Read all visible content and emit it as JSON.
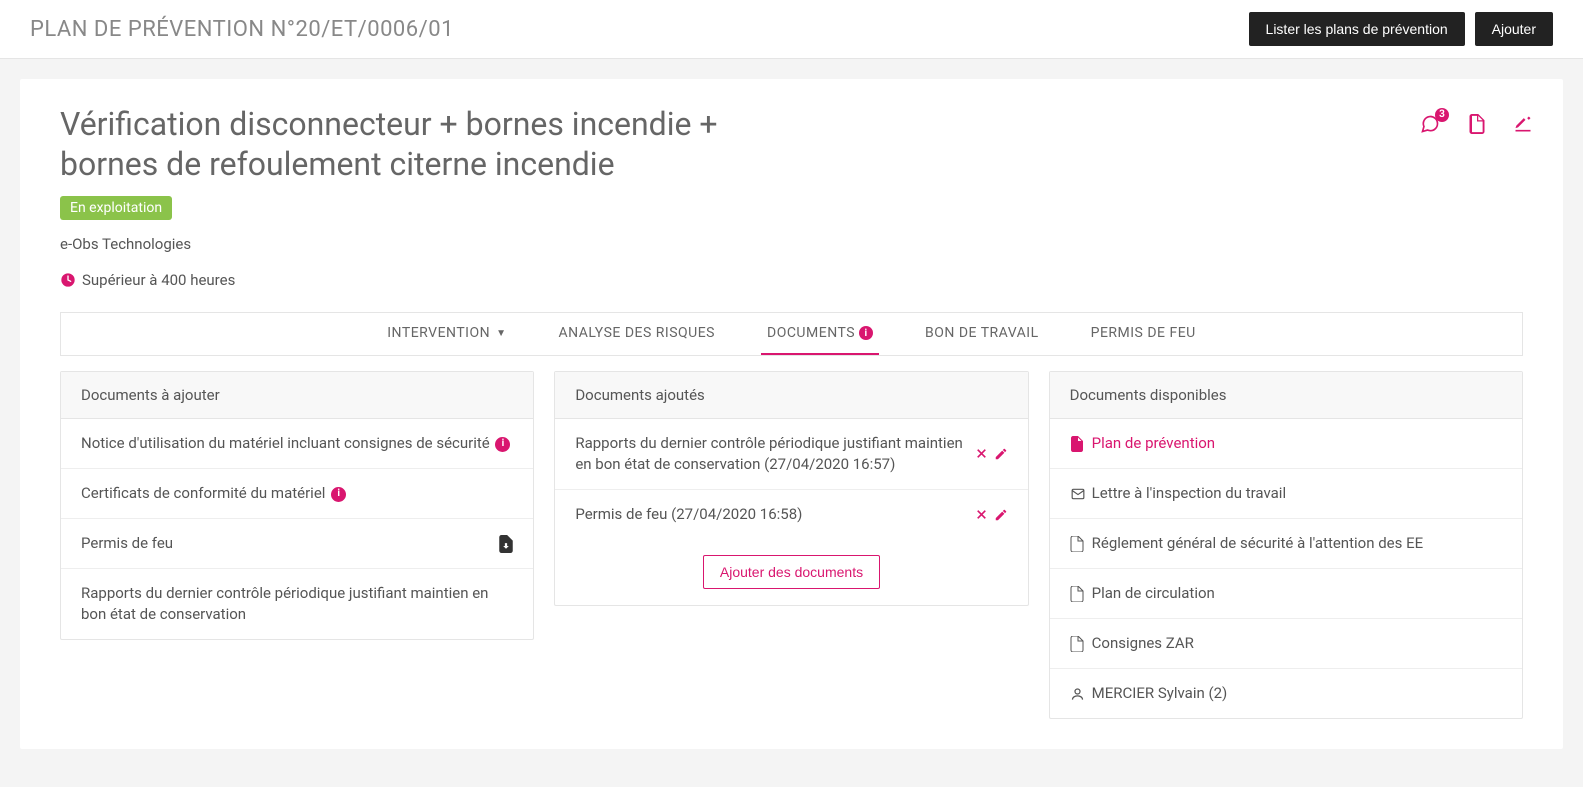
{
  "topbar": {
    "title": "PLAN DE PRÉVENTION N°20/ET/0006/01",
    "list_button": "Lister les plans de prévention",
    "add_button": "Ajouter"
  },
  "plan": {
    "title": "Vérification disconnecteur + bornes incendie + bornes de refoulement citerne incendie",
    "status": "En exploitation",
    "company": "e-Obs Technologies",
    "duration": "Supérieur à 400 heures",
    "comment_count": "3"
  },
  "tabs": {
    "intervention": "INTERVENTION",
    "risks": "ANALYSE DES RISQUES",
    "documents": "DOCUMENTS",
    "work_order": "BON DE TRAVAIL",
    "fire_permit": "PERMIS DE FEU"
  },
  "panels": {
    "to_add": {
      "title": "Documents à ajouter"
    },
    "added": {
      "title": "Documents ajoutés"
    },
    "available": {
      "title": "Documents disponibles"
    }
  },
  "docs_to_add": [
    {
      "label": "Notice d'utilisation du matériel incluant consignes de sécurité",
      "info": true
    },
    {
      "label": "Certificats de conformité du matériel",
      "info": true
    },
    {
      "label": "Permis de feu",
      "download": true
    },
    {
      "label": "Rapports du dernier contrôle périodique justifiant maintien en bon état de conservation"
    }
  ],
  "docs_added": [
    {
      "label": "Rapports du dernier contrôle périodique justifiant maintien en bon état de conservation (27/04/2020 16:57)"
    },
    {
      "label": "Permis de feu (27/04/2020 16:58)"
    }
  ],
  "add_documents_button": "Ajouter des documents",
  "docs_available": [
    {
      "label": "Plan de prévention",
      "icon": "pdf",
      "red": true
    },
    {
      "label": "Lettre à l'inspection du travail",
      "icon": "mail"
    },
    {
      "label": "Réglement général de sécurité à l'attention des EE",
      "icon": "file"
    },
    {
      "label": "Plan de circulation",
      "icon": "file"
    },
    {
      "label": "Consignes ZAR",
      "icon": "file"
    },
    {
      "label": "MERCIER Sylvain (2)",
      "icon": "user"
    }
  ]
}
